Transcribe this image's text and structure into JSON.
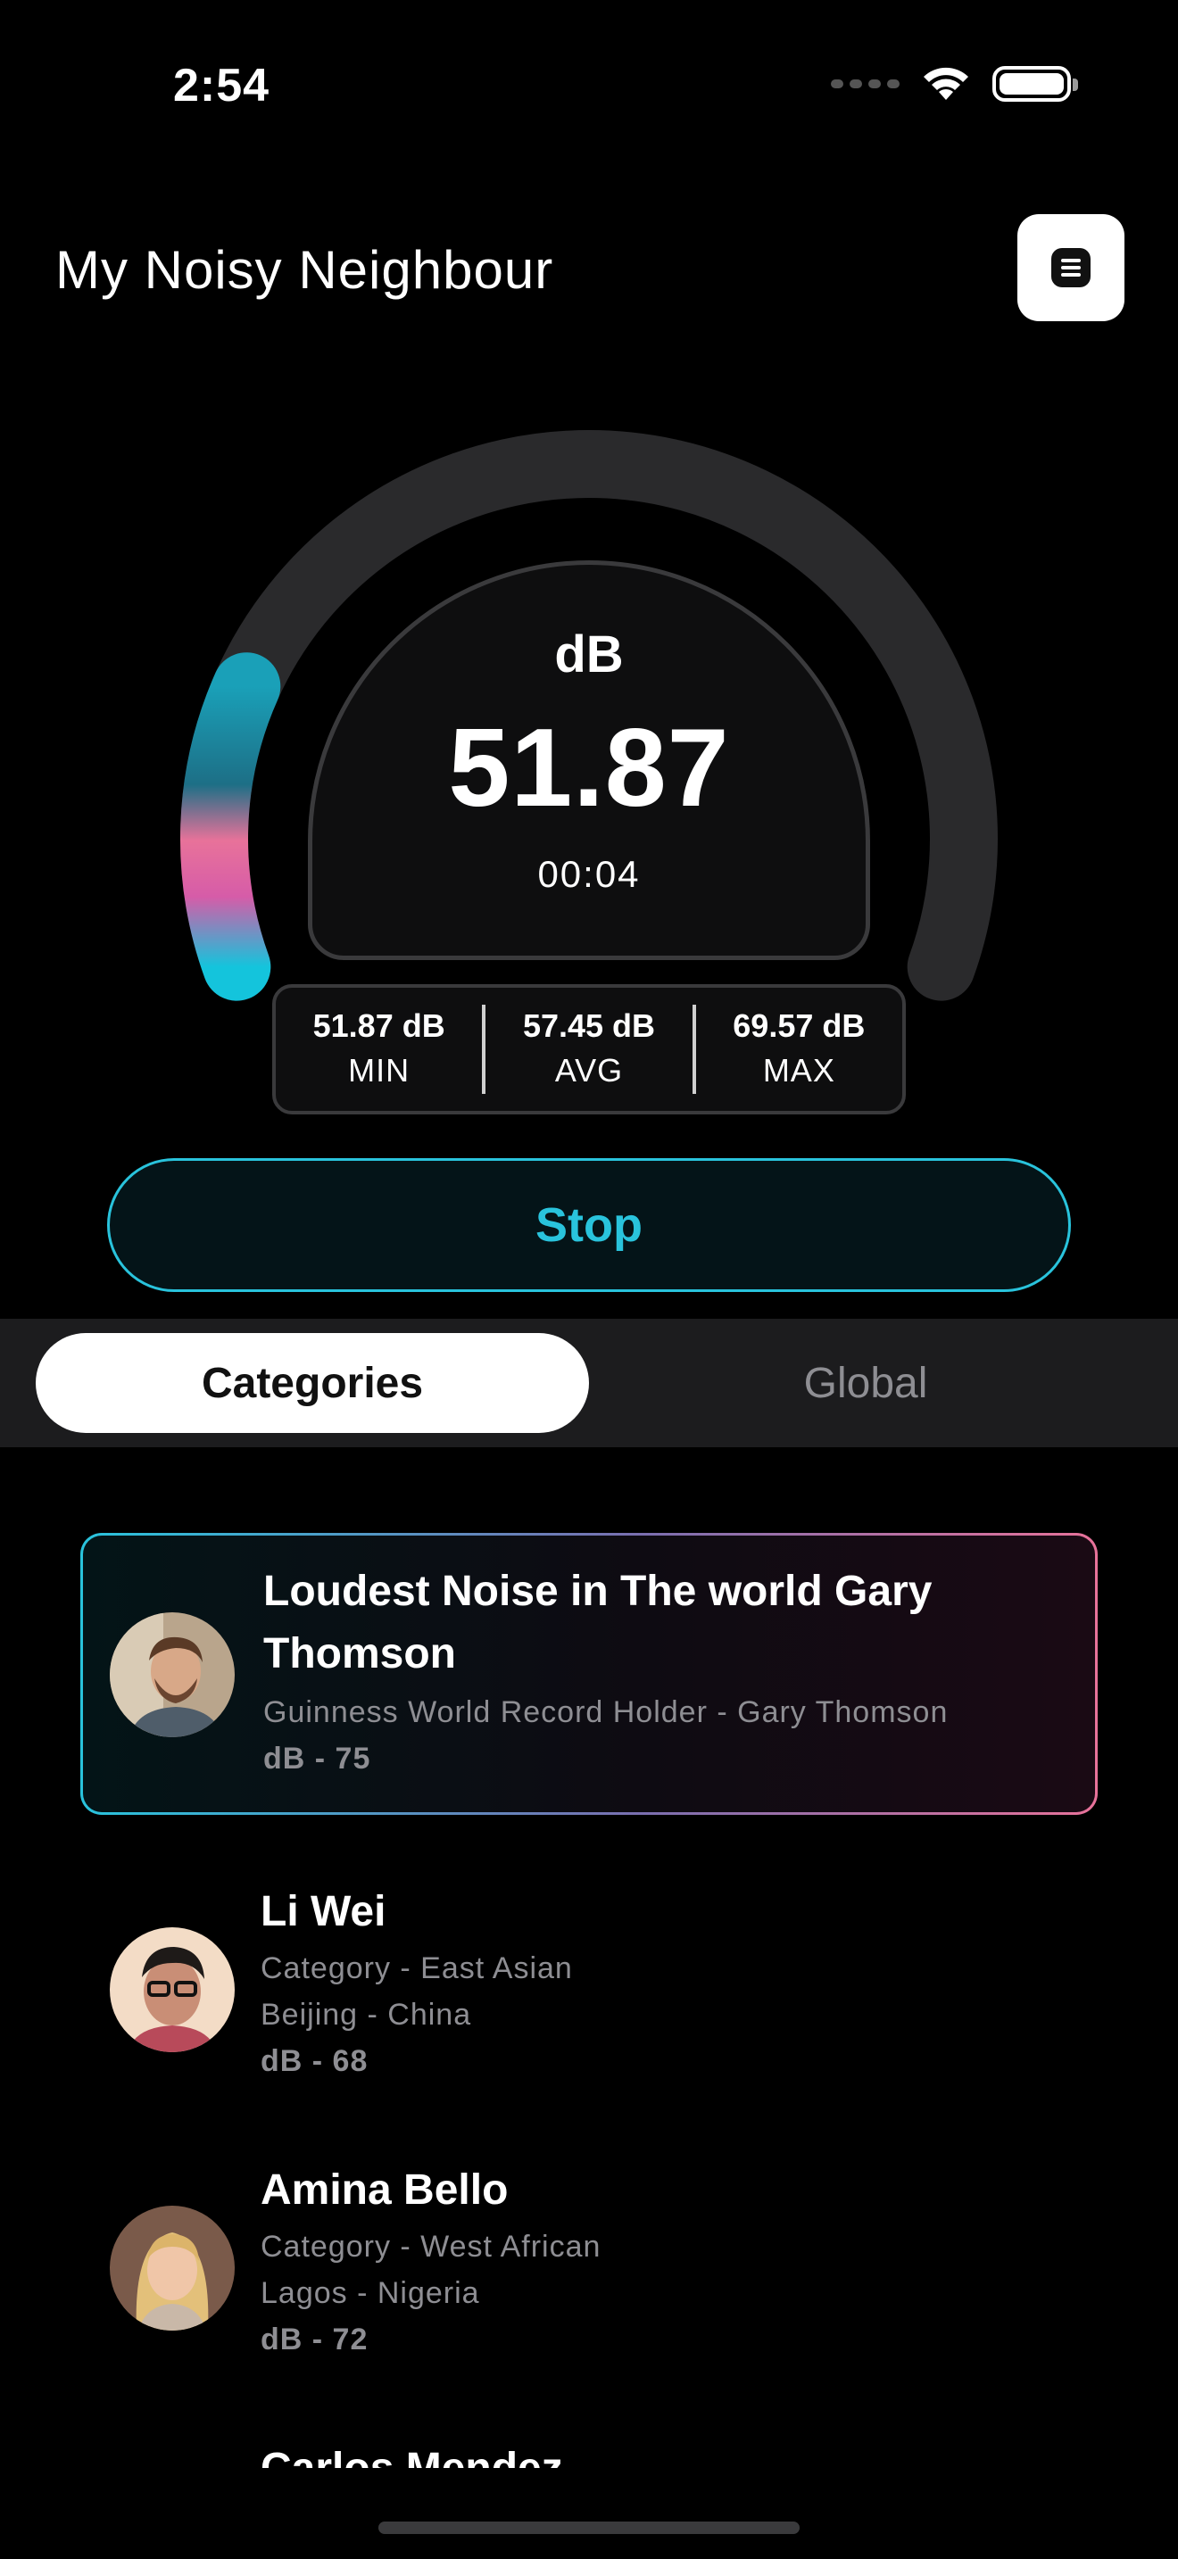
{
  "status_bar": {
    "time": "2:54"
  },
  "header": {
    "title": "My Noisy Neighbour",
    "menu_icon": "list-icon"
  },
  "meter": {
    "unit": "dB",
    "value": "51.87",
    "timer": "00:04",
    "level_fraction": 0.2,
    "stats": [
      {
        "value": "51.87 dB",
        "label": "MIN"
      },
      {
        "value": "57.45 dB",
        "label": "AVG"
      },
      {
        "value": "69.57 dB",
        "label": "MAX"
      }
    ]
  },
  "controls": {
    "stop_label": "Stop",
    "accent_color": "#29c3dc"
  },
  "tabs": {
    "active": "Categories",
    "inactive": "Global"
  },
  "list": [
    {
      "featured": true,
      "title": "Loudest Noise in The world Gary Thomson",
      "lines": [
        "Guinness World Record Holder - Gary Thomson"
      ],
      "db": "dB - 75"
    },
    {
      "title": "Li Wei",
      "lines": [
        "Category - East Asian",
        "Beijing - China"
      ],
      "db": "dB - 68"
    },
    {
      "title": "Amina Bello",
      "lines": [
        "Category - West African",
        "Lagos - Nigeria"
      ],
      "db": "dB - 72"
    },
    {
      "title": "Carlos Mendez"
    }
  ]
}
